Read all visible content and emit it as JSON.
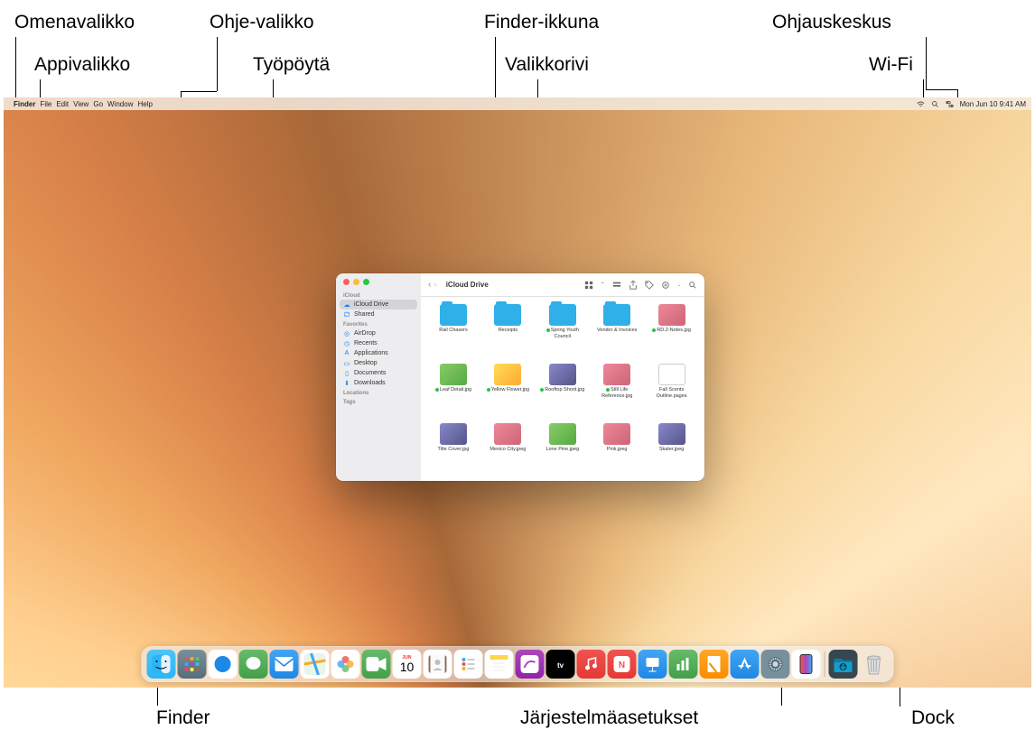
{
  "callouts": {
    "omena": "Omenavalikko",
    "appi": "Appivalikko",
    "ohje": "Ohje-valikko",
    "tyopyota": "Työpöytä",
    "finder_ikkuna": "Finder-ikkuna",
    "valikkorivi": "Valikkorivi",
    "ohjauskeskus": "Ohjauskeskus",
    "wifi": "Wi-Fi",
    "finder": "Finder",
    "jarjestelma": "Järjestelmäasetukset",
    "dock": "Dock"
  },
  "menubar": {
    "app": "Finder",
    "items": [
      "File",
      "Edit",
      "View",
      "Go",
      "Window",
      "Help"
    ],
    "datetime": "Mon Jun 10  9:41 AM"
  },
  "finder": {
    "title": "iCloud Drive",
    "sidebar": {
      "sections": [
        {
          "label": "iCloud",
          "items": [
            {
              "icon": "cloud",
              "label": "iCloud Drive",
              "selected": true
            },
            {
              "icon": "folder-shared",
              "label": "Shared"
            }
          ]
        },
        {
          "label": "Favorites",
          "items": [
            {
              "icon": "airdrop",
              "label": "AirDrop"
            },
            {
              "icon": "clock",
              "label": "Recents"
            },
            {
              "icon": "apps",
              "label": "Applications"
            },
            {
              "icon": "desktop",
              "label": "Desktop"
            },
            {
              "icon": "doc",
              "label": "Documents"
            },
            {
              "icon": "download",
              "label": "Downloads"
            }
          ]
        },
        {
          "label": "Locations",
          "items": []
        },
        {
          "label": "Tags",
          "items": []
        }
      ]
    },
    "files": [
      {
        "type": "folder",
        "name": "Rail Chasers"
      },
      {
        "type": "folder",
        "name": "Receipts"
      },
      {
        "type": "folder",
        "name": "Spring Youth Council",
        "tag": true
      },
      {
        "type": "folder",
        "name": "Vendor & Invoices"
      },
      {
        "type": "img",
        "name": "RD.2-Notes.jpg",
        "tag": true
      },
      {
        "type": "img2",
        "name": "Leaf Detail.jpg",
        "tag": true
      },
      {
        "type": "img3",
        "name": "Yellow Flower.jpg",
        "tag": true
      },
      {
        "type": "img4",
        "name": "Rooftop Shoot.jpg",
        "tag": true
      },
      {
        "type": "img",
        "name": "Still Life Reference.jpg",
        "tag": true
      },
      {
        "type": "doc",
        "name": "Fall Scents Outline.pages"
      },
      {
        "type": "img4",
        "name": "Title Cover.jpg"
      },
      {
        "type": "img",
        "name": "Mexico City.jpeg"
      },
      {
        "type": "img2",
        "name": "Lone Pine.jpeg"
      },
      {
        "type": "img",
        "name": "Pink.jpeg"
      },
      {
        "type": "img4",
        "name": "Skater.jpeg"
      }
    ]
  },
  "dock": {
    "cal_month": "JUN",
    "cal_day": "10",
    "apps": [
      "finder",
      "launchpad",
      "safari",
      "messages",
      "mail",
      "maps",
      "photos",
      "facetime",
      "calendar",
      "contacts",
      "reminders",
      "notes",
      "freeform",
      "tv",
      "music",
      "news",
      "keynote",
      "numbers",
      "pages",
      "appstore",
      "system-settings",
      "iphone-mirroring"
    ],
    "right": [
      "downloads",
      "trash"
    ]
  }
}
